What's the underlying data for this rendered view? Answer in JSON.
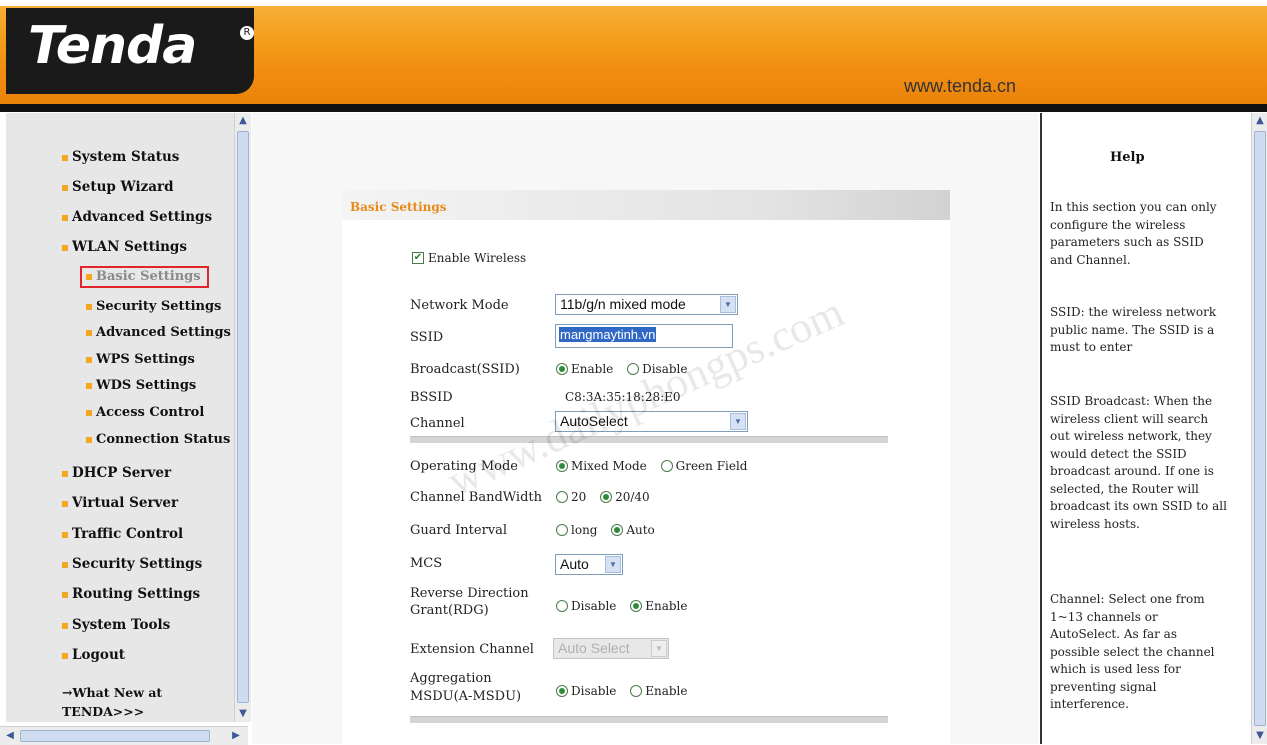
{
  "header": {
    "logo_text": "Tenda",
    "logo_mark": "R",
    "url": "www.tenda.cn"
  },
  "sidebar": {
    "items": [
      {
        "label": "System Status"
      },
      {
        "label": "Setup Wizard"
      },
      {
        "label": "Advanced Settings"
      },
      {
        "label": "WLAN Settings"
      },
      {
        "label": "Basic Settings",
        "active": true
      },
      {
        "label": "Security Settings"
      },
      {
        "label": "Advanced Settings"
      },
      {
        "label": "WPS Settings"
      },
      {
        "label": "WDS Settings"
      },
      {
        "label": "Access Control"
      },
      {
        "label": "Connection Status"
      },
      {
        "label": "DHCP Server"
      },
      {
        "label": "Virtual Server"
      },
      {
        "label": "Traffic Control"
      },
      {
        "label": "Security Settings"
      },
      {
        "label": "Routing Settings"
      },
      {
        "label": "System Tools"
      },
      {
        "label": "Logout"
      }
    ],
    "whatsnew_line1": "→What New at",
    "whatsnew_line2": "TENDA>>>"
  },
  "panel": {
    "title": "Basic Settings",
    "enable_wireless": "Enable Wireless",
    "network_mode_label": "Network Mode",
    "network_mode_value": "11b/g/n mixed mode",
    "ssid_label": "SSID",
    "ssid_value": "mangmaytinh.vn",
    "broadcast_label": "Broadcast(SSID)",
    "bssid_label": "BSSID",
    "bssid_value": "C8:3A:35:18:28:E0",
    "channel_label": "Channel",
    "channel_value": "AutoSelect",
    "operating_mode_label": "Operating Mode",
    "mixed_mode": "Mixed Mode",
    "green_field": "Green Field",
    "bandwidth_label": "Channel BandWidth",
    "bw20": "20",
    "bw2040": "20/40",
    "guard_label": "Guard Interval",
    "guard_long": "long",
    "guard_auto": "Auto",
    "mcs_label": "MCS",
    "mcs_value": "Auto",
    "rdg_label_1": "Reverse Direction",
    "rdg_label_2": "Grant(RDG)",
    "ext_channel_label": "Extension Channel",
    "ext_channel_value": "Auto Select",
    "amsdu_label_1": "Aggregation",
    "amsdu_label_2": "MSDU(A-MSDU)",
    "enable": "Enable",
    "disable": "Disable",
    "watermark": "www.dailyphongps.com"
  },
  "help": {
    "title": "Help",
    "p1": "In this section you can only configure the wireless parameters such as SSID and Channel.",
    "p2": "SSID: the wireless network public name. The SSID is a must to enter",
    "p3": "SSID Broadcast: When the wireless client will search out wireless network, they would detect the SSID broadcast around. If one is selected, the Router will broadcast its own SSID to all wireless hosts.",
    "p4": "Channel: Select one from 1~13 channels or AutoSelect. As far as possible select the channel which is used less for preventing signal interference."
  }
}
